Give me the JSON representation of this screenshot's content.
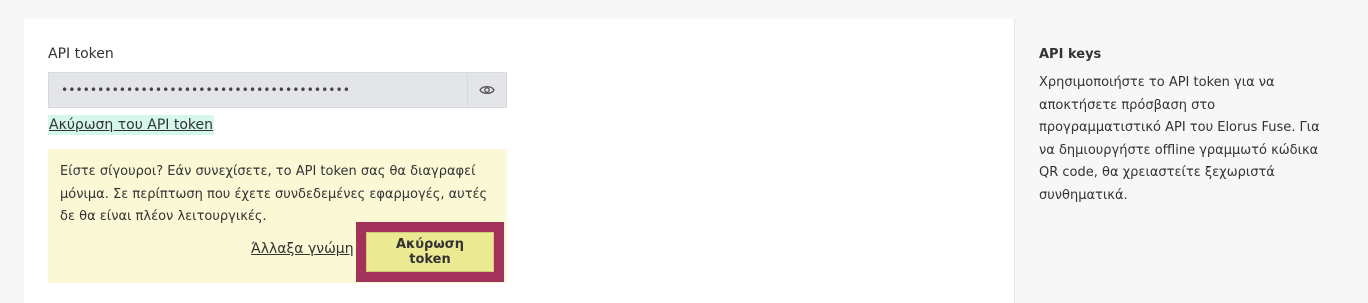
{
  "form": {
    "token_label": "API token",
    "token_value": "••••••••••••••••••••••••••••••••••••••••",
    "revoke_link": "Ακύρωση του API token"
  },
  "confirm": {
    "message": "Είστε σίγουροι? Εάν συνεχίσετε, το API token σας θα διαγραφεί μόνιμα. Σε περίπτωση που έχετε συνδεδεμένες εφαρμογές, αυτές δε θα είναι πλέον λειτουργικές.",
    "cancel_label": "Άλλαξα γνώμη",
    "confirm_label": "Ακύρωση token"
  },
  "sidebar": {
    "title": "API keys",
    "description": "Χρησιμοποιήστε το API token για να αποκτήσετε πρόσβαση στο προγραμματιστικό API του Elorus Fuse. Για να δημιουργήστε offline γραμμωτό κώδικα QR code, θα χρειαστείτε ξεχωριστά συνθηματικά."
  },
  "icons": {
    "reveal": "eye-icon"
  },
  "colors": {
    "confirm_box_bg": "#fbf8d6",
    "highlight_border": "#a3325b",
    "confirm_button_bg": "#ece993",
    "link_highlight": "#d5f7ec"
  }
}
